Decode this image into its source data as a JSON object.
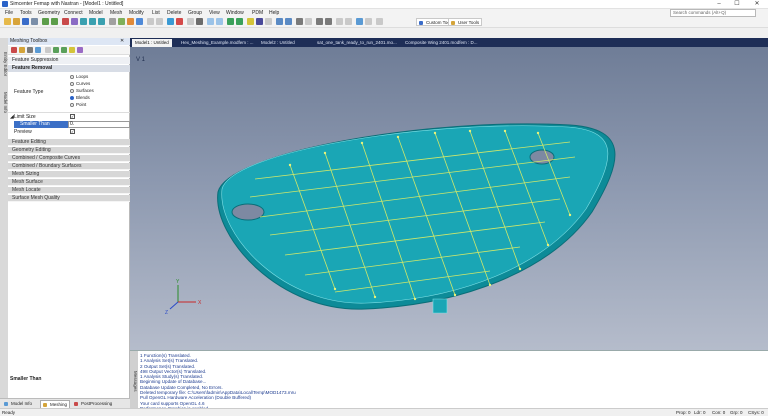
{
  "window": {
    "title": "Simcenter Femap with Nastran - [Model1 : Untitled]",
    "minimize": "–",
    "maximize": "☐",
    "close": "✕"
  },
  "menu": [
    "File",
    "Tools",
    "Geometry",
    "Connect",
    "Model",
    "Mesh",
    "Modify",
    "List",
    "Delete",
    "Group",
    "View",
    "Window",
    "PDM",
    "Help"
  ],
  "search": {
    "placeholder": "Search commands (Alt+Q)"
  },
  "toolbar": {
    "custom_tools": "Custom Tools",
    "user_tools": "User Tools"
  },
  "left_tabs": [
    "Entity Editor",
    "Model Info"
  ],
  "toolbox": {
    "title": "Meshing Toolbox",
    "sections": {
      "feature_suppression": "Feature Suppression",
      "feature_removal": "Feature Removal",
      "feature_type_label": "Feature Type",
      "feature_types": [
        {
          "label": "Loops",
          "selected": false
        },
        {
          "label": "Curves",
          "selected": false
        },
        {
          "label": "Surfaces",
          "selected": false
        },
        {
          "label": "Blends",
          "selected": true
        },
        {
          "label": "Point",
          "selected": false
        }
      ],
      "limit_size": "Limit Size",
      "smaller_than": "Smaller Than",
      "smaller_than_value": "0.",
      "preview": "Preview"
    },
    "more_sections": [
      "Feature Editing",
      "Geometry Editing",
      "Combined / Composite Curves",
      "Combined / Boundary Surfaces",
      "Mesh Sizing",
      "Mesh Surface",
      "Mesh Locate",
      "Surface Mesh Quality"
    ],
    "footer_label": "Smaller Than"
  },
  "bottom_tabs": [
    "Model Info",
    "Meshing",
    "PostProcessing"
  ],
  "doc_tabs": [
    "Model1 : Untitled",
    "Hex_Meshing_Example.modfem : ...",
    "Model2 : Untitled",
    "sat_one_tank_ready_to_run_2401.mo...",
    "Composite Wing 2401.modfem : D..."
  ],
  "viewport": {
    "label": "V 1"
  },
  "messages_tab": "Messages",
  "messages": [
    "1 Function(s) Translated.",
    "1 Analysis Set(s) Translated.",
    "2 Output Set(s) Translated.",
    "498 Output Vector(s) Translated.",
    "1 Analysis Study(s) Translated.",
    "Beginning Update of Database...",
    "Database Update Completed, No Errors.",
    "Deleted temporary file: C:\\Users\\fadmin\\AppData\\Local\\Temp\\MOD1473.mru",
    "Pull OpenGL Hardware Acceleration (Double Buffered)",
    "Your card supports OpenGL 4.6",
    "Performance Graphics is enabled"
  ],
  "status": {
    "ready": "Ready",
    "prop": "Prop: 0",
    "ldr": "Ldr: 0",
    "con": "Con: 0",
    "grp": "Grp: 0",
    "csys": "CSys: 0"
  },
  "colors": {
    "part_fill": "#1aa6b5",
    "mesh_lines": "#cfe86a",
    "viewport_top": "#6f7d97",
    "viewport_bottom": "#b5bccb",
    "selected_row": "#3b6fc6"
  }
}
